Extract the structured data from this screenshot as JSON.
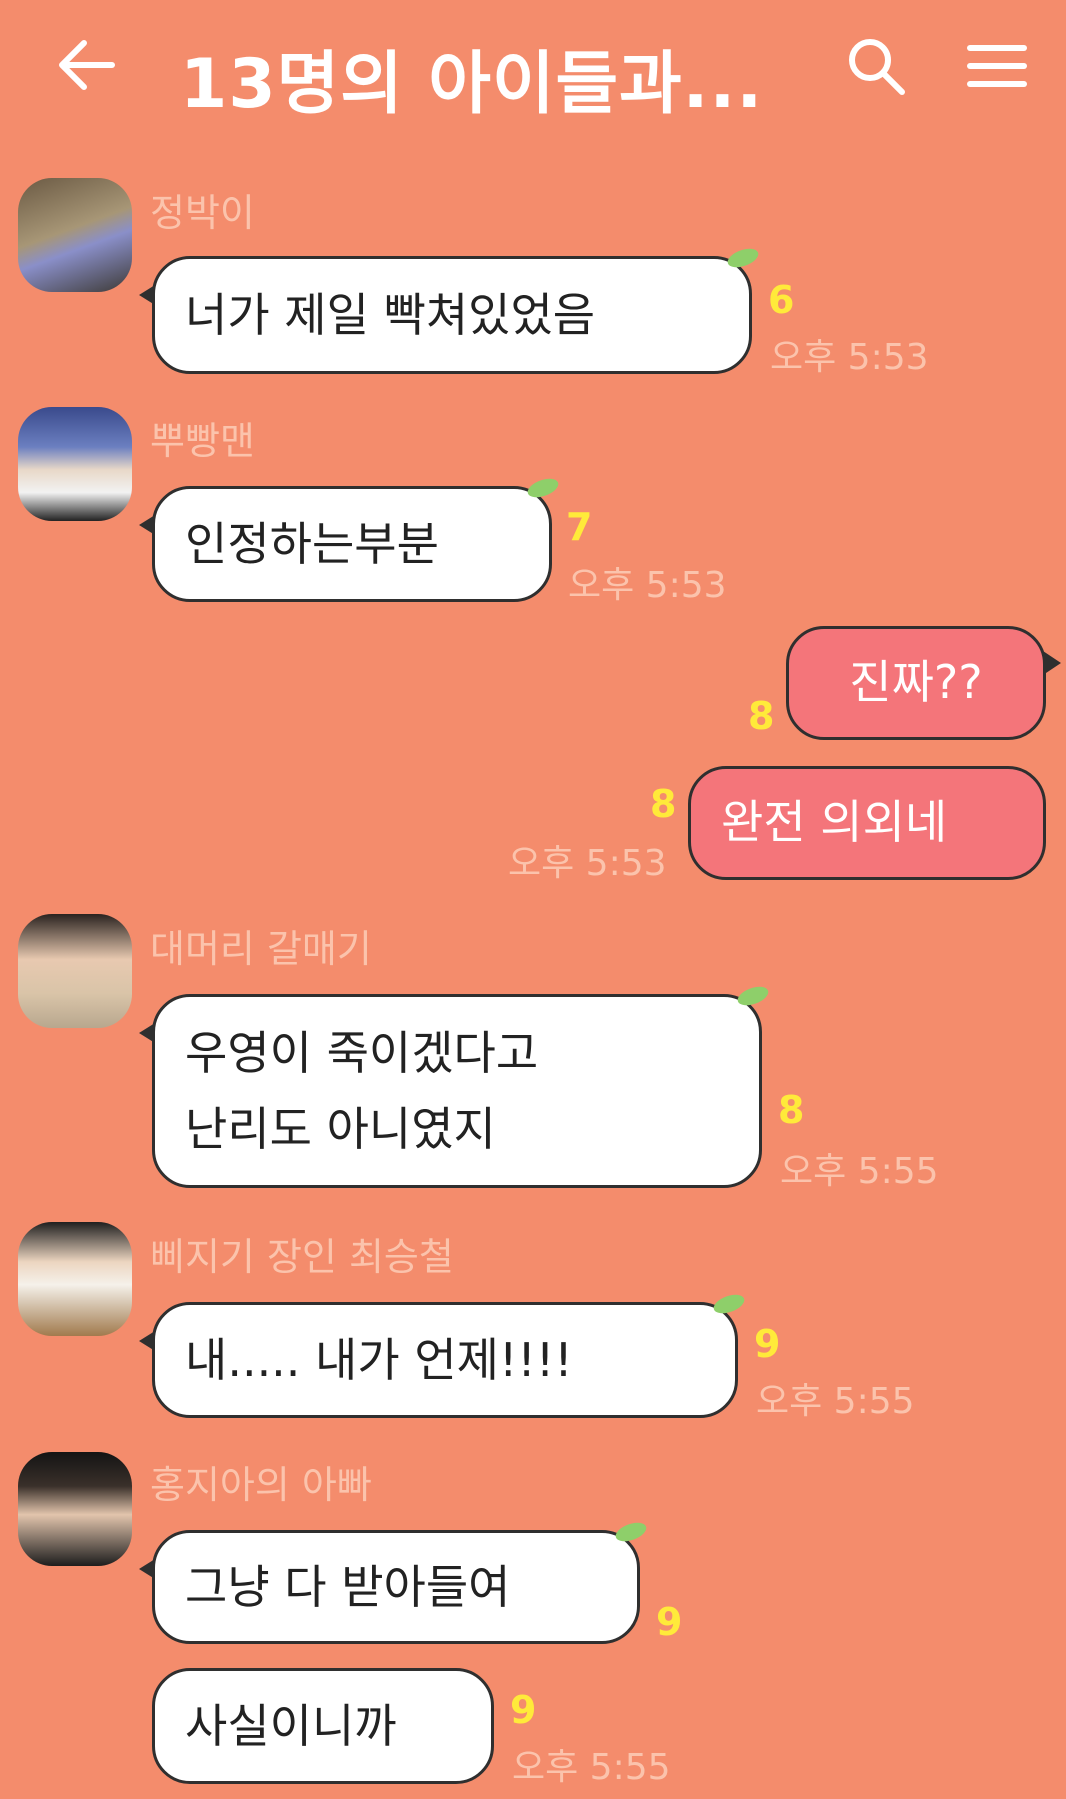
{
  "header": {
    "title": "13명의 아이들과...",
    "back_icon": "arrow-left-icon",
    "search_icon": "search-icon",
    "menu_icon": "hamburger-menu-icon",
    "icon_color": "#ffffff"
  },
  "colors": {
    "background": "#f48c6c",
    "bubble_received": "#ffffff",
    "bubble_sent": "#f4757a",
    "unread_count": "#ffea3a",
    "name_and_time": "#fbc3ac"
  },
  "messages": [
    {
      "sender": "정박이",
      "avatar": "avatar-jeongbak",
      "text_lines": [
        "너가 제일 빡쳐있었음"
      ],
      "unread": "6",
      "time": "오후 5:53"
    },
    {
      "sender": "뿌빵맨",
      "avatar": "avatar-ppuppang",
      "text_lines": [
        "인정하는부분"
      ],
      "unread": "7",
      "time": "오후 5:53"
    },
    {
      "sender": "",
      "mine": true,
      "text_lines": [
        "진짜??"
      ],
      "unread": "8",
      "time": ""
    },
    {
      "sender": "",
      "mine": true,
      "text_lines": [
        "완전 의외네"
      ],
      "unread": "8",
      "time": "오후 5:53"
    },
    {
      "sender": "대머리 갈매기",
      "avatar": "avatar-daemeori",
      "text_lines": [
        "우영이 죽이겠다고",
        "난리도 아니였지"
      ],
      "unread": "8",
      "time": "오후 5:55"
    },
    {
      "sender": "삐지기 장인 최승철",
      "avatar": "avatar-seungcheol",
      "text_lines": [
        "내..... 내가 언제!!!!"
      ],
      "unread": "9",
      "time": "오후 5:55"
    },
    {
      "sender": "홍지아의 아빠",
      "avatar": "avatar-hongjia",
      "text_lines": [
        "그냥 다 받아들여"
      ],
      "unread": "9",
      "time": ""
    },
    {
      "sender": "",
      "text_lines": [
        "사실이니까"
      ],
      "unread": "9",
      "time": "오후 5:55"
    }
  ]
}
